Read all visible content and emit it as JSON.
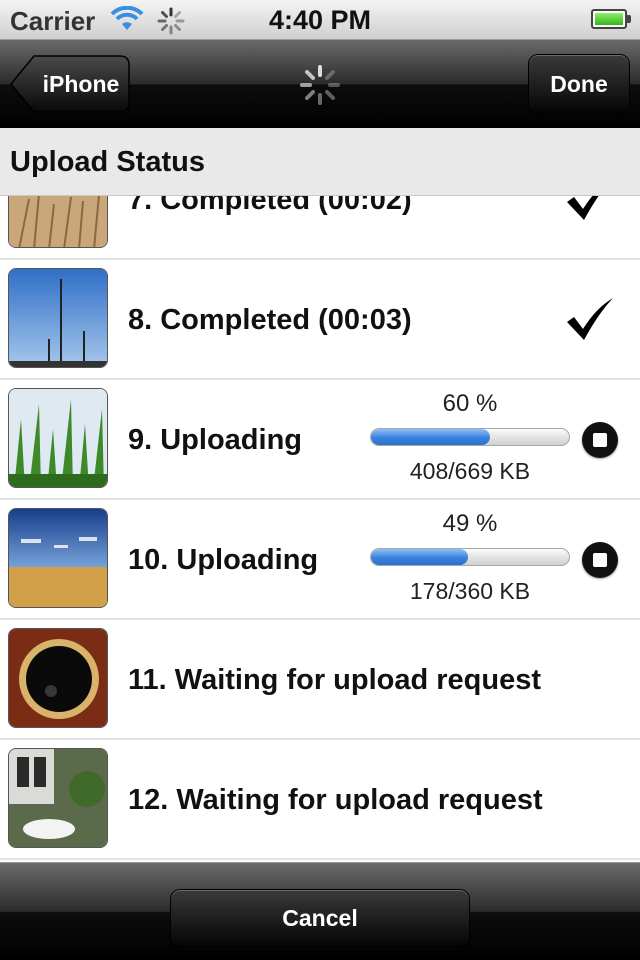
{
  "status_bar": {
    "carrier": "Carrier",
    "time": "4:40 PM",
    "icons": [
      "wifi-icon",
      "activity-spinner-icon",
      "battery-icon"
    ]
  },
  "nav": {
    "back_label": "iPhone",
    "done_label": "Done",
    "activity": "loading-spinner-icon"
  },
  "section": {
    "title": "Upload Status"
  },
  "uploads": [
    {
      "label": "7. Completed (00:02)",
      "state": "completed",
      "icon": "checkmark-icon"
    },
    {
      "label": "8. Completed (00:03)",
      "state": "completed",
      "icon": "checkmark-icon"
    },
    {
      "label": "9. Uploading",
      "state": "uploading",
      "percent_text": "60 %",
      "progress": 0.6,
      "size_text": "408/669 KB",
      "icon": "stop-icon"
    },
    {
      "label": "10. Uploading",
      "state": "uploading",
      "percent_text": "49 %",
      "progress": 0.49,
      "size_text": "178/360 KB",
      "icon": "stop-icon"
    },
    {
      "label": "11. Waiting for upload request",
      "state": "waiting"
    },
    {
      "label": "12. Waiting for upload request",
      "state": "waiting"
    }
  ],
  "toolbar": {
    "cancel_label": "Cancel"
  },
  "colors": {
    "progress": "#3a82e0",
    "bar_dark": "#000000"
  }
}
